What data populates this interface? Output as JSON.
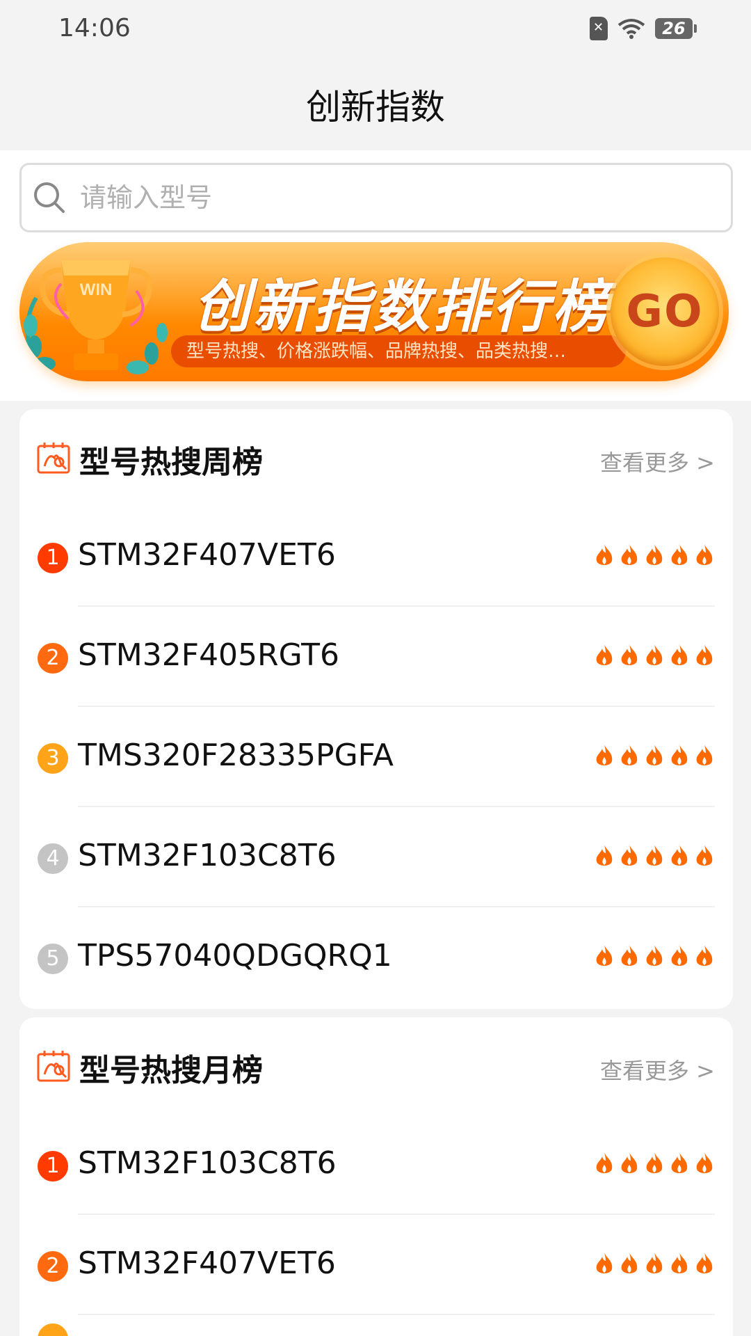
{
  "status_bar": {
    "time": "14:06",
    "battery": "26"
  },
  "nav": {
    "title": "创新指数"
  },
  "search": {
    "placeholder": "请输入型号"
  },
  "banner": {
    "trophy_text": "WIN",
    "title": "创新指数排行榜",
    "subtitle": "型号热搜、价格涨跌幅、品牌热搜、品类热搜…",
    "go_label": "GO"
  },
  "colors": {
    "rank1": "#ff3b00",
    "rank2": "#ff6a10",
    "rank3": "#ffa318",
    "rank_other": "#c4c4c4",
    "flame": "#ff6a00"
  },
  "weekly": {
    "title": "型号热搜周榜",
    "more": "查看更多 >",
    "items": [
      {
        "rank": "1",
        "name": "STM32F407VET6",
        "flames": 5
      },
      {
        "rank": "2",
        "name": "STM32F405RGT6",
        "flames": 5
      },
      {
        "rank": "3",
        "name": "TMS320F28335PGFA",
        "flames": 5
      },
      {
        "rank": "4",
        "name": "STM32F103C8T6",
        "flames": 5
      },
      {
        "rank": "5",
        "name": "TPS57040QDGQRQ1",
        "flames": 5
      }
    ]
  },
  "monthly": {
    "title": "型号热搜月榜",
    "more": "查看更多 >",
    "items": [
      {
        "rank": "1",
        "name": "STM32F103C8T6",
        "flames": 5
      },
      {
        "rank": "2",
        "name": "STM32F407VET6",
        "flames": 5
      }
    ]
  }
}
